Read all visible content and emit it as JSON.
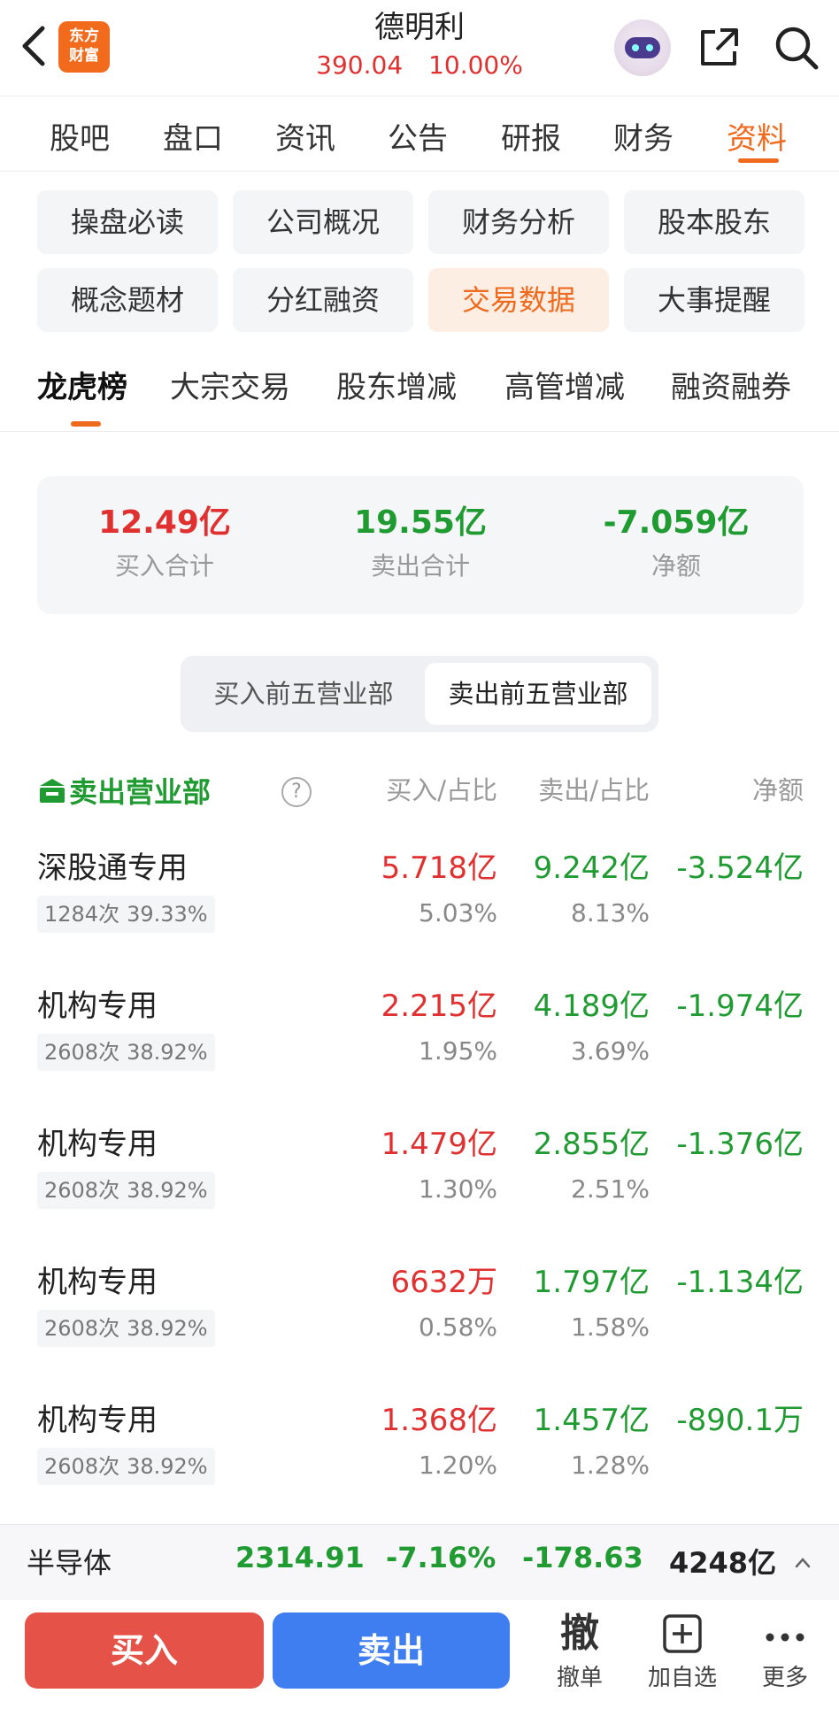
{
  "header": {
    "stock_name": "德明利",
    "price": "390.04",
    "change_pct": "10.00%",
    "logo_text_1": "东方",
    "logo_text_2": "财富"
  },
  "main_tabs": [
    "股吧",
    "盘口",
    "资讯",
    "公告",
    "研报",
    "财务",
    "资料"
  ],
  "main_tabs_active": "资料",
  "sub_chips": [
    "操盘必读",
    "公司概况",
    "财务分析",
    "股本股东",
    "概念题材",
    "分红融资",
    "交易数据",
    "大事提醒"
  ],
  "sub_chips_active": "交易数据",
  "third_tabs": [
    "龙虎榜",
    "大宗交易",
    "股东增减",
    "高管增减",
    "融资融券"
  ],
  "third_tabs_active": "龙虎榜",
  "summary": {
    "buy_total": "12.49亿",
    "buy_label": "买入合计",
    "sell_total": "19.55亿",
    "sell_label": "卖出合计",
    "net": "-7.059亿",
    "net_label": "净额"
  },
  "toggle": {
    "option_buy": "买入前五营业部",
    "option_sell": "卖出前五营业部",
    "active": "卖出前五营业部"
  },
  "list_header": {
    "title": "卖出营业部",
    "col_buy": "买入/占比",
    "col_sell": "卖出/占比",
    "col_net": "净额"
  },
  "rows": [
    {
      "name": "深股通专用",
      "count": "1284次",
      "rate": "39.33%",
      "buy": "5.718亿",
      "buy_pct": "5.03%",
      "sell": "9.242亿",
      "sell_pct": "8.13%",
      "net": "-3.524亿"
    },
    {
      "name": "机构专用",
      "count": "2608次",
      "rate": "38.92%",
      "buy": "2.215亿",
      "buy_pct": "1.95%",
      "sell": "4.189亿",
      "sell_pct": "3.69%",
      "net": "-1.974亿"
    },
    {
      "name": "机构专用",
      "count": "2608次",
      "rate": "38.92%",
      "buy": "1.479亿",
      "buy_pct": "1.30%",
      "sell": "2.855亿",
      "sell_pct": "2.51%",
      "net": "-1.376亿"
    },
    {
      "name": "机构专用",
      "count": "2608次",
      "rate": "38.92%",
      "buy": "6632万",
      "buy_pct": "0.58%",
      "sell": "1.797亿",
      "sell_pct": "1.58%",
      "net": "-1.134亿"
    },
    {
      "name": "机构专用",
      "count": "2608次",
      "rate": "38.92%",
      "buy": "1.368亿",
      "buy_pct": "1.20%",
      "sell": "1.457亿",
      "sell_pct": "1.28%",
      "net": "-890.1万"
    }
  ],
  "industry": {
    "name": "半导体",
    "index": "2314.91",
    "change_pct": "-7.16%",
    "change": "-178.63",
    "amount": "4248亿"
  },
  "actions": {
    "buy": "买入",
    "sell": "卖出",
    "cancel_icon": "撤",
    "cancel": "撤单",
    "watchlist": "加自选",
    "more": "更多"
  },
  "colors": {
    "accent": "#f06a1e",
    "up_red": "#e0302f",
    "down_green": "#1f9b32",
    "buy_button": "#e55247",
    "sell_button": "#3f7ef0"
  }
}
